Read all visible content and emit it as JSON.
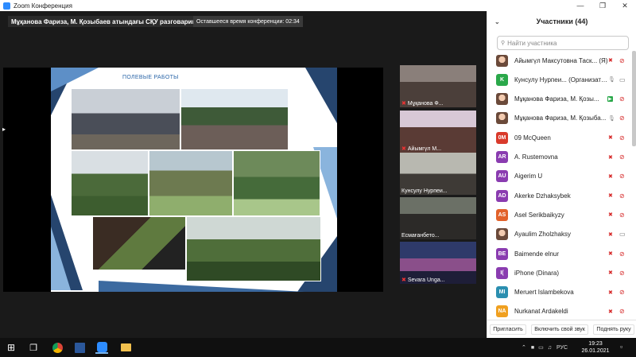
{
  "window": {
    "title": "Zoom Конференция"
  },
  "meeting": {
    "speaker_label": "Мұқанова Фариза, М. Қозыбаев атындағы СҚУ разговаривает...",
    "timer": "Оставшееся время конференции: 02:34",
    "slide_heading": "ПОЛЕВЫЕ РАБОТЫ"
  },
  "thumbnails": [
    {
      "label": "Мұқанова Ф...",
      "muted": true
    },
    {
      "label": "Айымгүл М...",
      "muted": true
    },
    {
      "label": "Кунсулу Нурпеи...",
      "muted": false
    },
    {
      "label": "Есмағанбето...",
      "muted": false
    },
    {
      "label": "Sevara Unga...",
      "muted": true
    }
  ],
  "participants": {
    "title": "Участники (44)",
    "search_placeholder": "Найти участника",
    "items": [
      {
        "name": "Айымгүл Максутовна Таск... (Я)",
        "avatar_text": "",
        "avatar_color": "",
        "mic": "muted",
        "cam": "off"
      },
      {
        "name": "Кунсулу Нурпеи... (Организатор)",
        "avatar_text": "K",
        "avatar_color": "#2aa84a",
        "mic": "on",
        "cam": "on"
      },
      {
        "name": "Мұқанова Фариза, М. Қозы...",
        "avatar_text": "",
        "avatar_color": "",
        "mic": "green",
        "cam": "off"
      },
      {
        "name": "Мұқанова Фариза, М. Қозыба...",
        "avatar_text": "",
        "avatar_color": "",
        "mic": "on",
        "cam": "off"
      },
      {
        "name": "09 McQueen",
        "avatar_text": "0M",
        "avatar_color": "#d93a2b",
        "mic": "muted",
        "cam": "off"
      },
      {
        "name": "A. Rustemovna",
        "avatar_text": "AR",
        "avatar_color": "#8a3cb0",
        "mic": "muted",
        "cam": "off"
      },
      {
        "name": "Aigerim U",
        "avatar_text": "AU",
        "avatar_color": "#8a3cb0",
        "mic": "muted",
        "cam": "off"
      },
      {
        "name": "Akerke Dzhaksybek",
        "avatar_text": "AD",
        "avatar_color": "#8a3cb0",
        "mic": "muted",
        "cam": "off"
      },
      {
        "name": "Asel Serikbaikyzy",
        "avatar_text": "AS",
        "avatar_color": "#e2622b",
        "mic": "muted",
        "cam": "off"
      },
      {
        "name": "Ayaulim Zholzhaksy",
        "avatar_text": "",
        "avatar_color": "",
        "mic": "muted",
        "cam": "on"
      },
      {
        "name": "Baimende elnur",
        "avatar_text": "BE",
        "avatar_color": "#8a3cb0",
        "mic": "muted",
        "cam": "off"
      },
      {
        "name": "iPhone (Dinara)",
        "avatar_text": "I(",
        "avatar_color": "#8a3cb0",
        "mic": "muted",
        "cam": "off"
      },
      {
        "name": "Meruert Islambekova",
        "avatar_text": "MI",
        "avatar_color": "#2b8fb0",
        "mic": "muted",
        "cam": "off"
      },
      {
        "name": "Nurkanat Ardakeldi",
        "avatar_text": "NA",
        "avatar_color": "#f0a020",
        "mic": "muted",
        "cam": "off"
      }
    ],
    "footer": {
      "invite": "Пригласить",
      "unmute": "Включить свой звук",
      "raise_hand": "Поднять руку"
    }
  },
  "taskbar": {
    "lang": "РУС",
    "time": "19:23",
    "date": "26.01.2021"
  }
}
